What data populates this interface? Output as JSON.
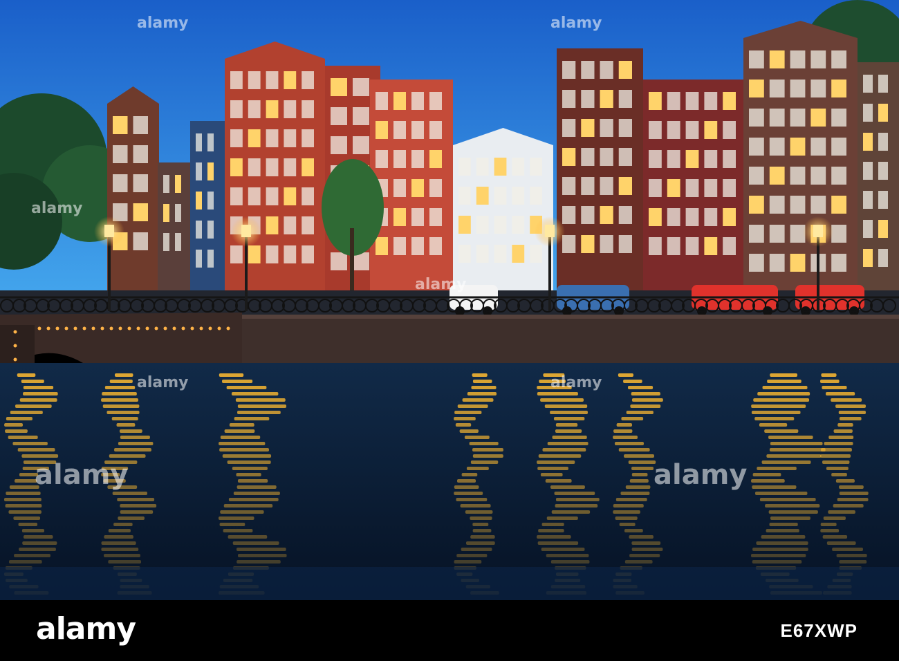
{
  "watermark": {
    "text": "alamy",
    "color": "#ffffff"
  },
  "footer": {
    "logo": "alamy",
    "image_id": "E67XWP"
  },
  "palette": {
    "sky_top": "#1f6fd6",
    "sky_bottom": "#3fa6ee",
    "water": "#0a1a33",
    "reflection": "#f4b431",
    "brick": "#a23a2a",
    "window_lit": "#ffd36a"
  }
}
